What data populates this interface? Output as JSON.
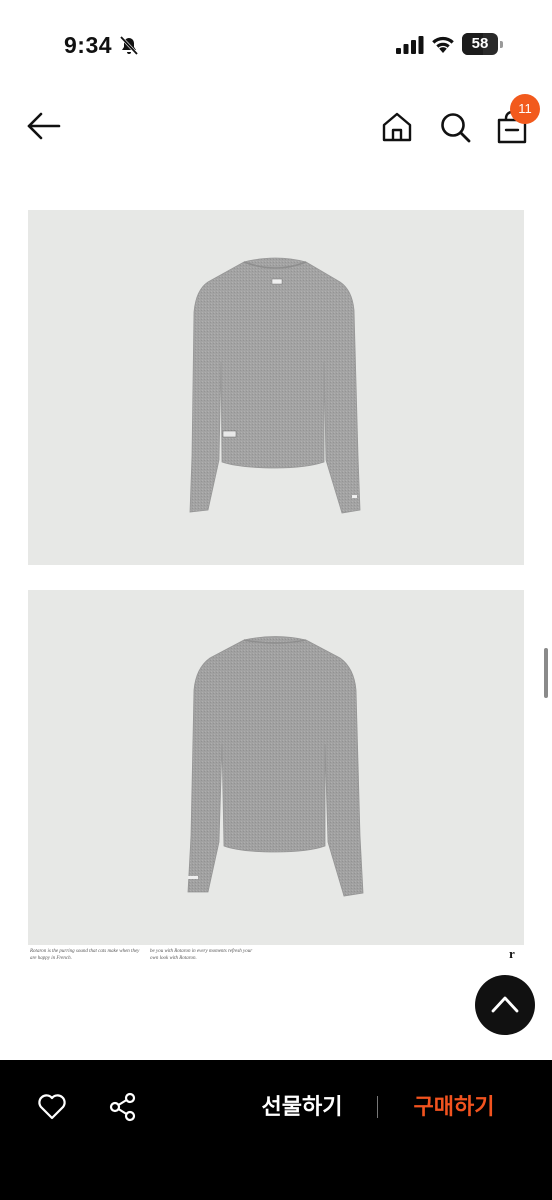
{
  "status_bar": {
    "time": "9:34",
    "battery_level": "58"
  },
  "nav": {
    "cart_count": "11"
  },
  "product_images": [
    {
      "view": "front",
      "color": "#a2a2a2"
    },
    {
      "view": "back",
      "color": "#a0a0a0"
    }
  ],
  "footer": {
    "caption_left": "Rotaron is the purring sound that cats make when they are happy in French.",
    "caption_right": "be you with Rotaron in every moments refresh your own look with Rotaron.",
    "brand_mark": "r"
  },
  "actions": {
    "gift_label": "선물하기",
    "buy_label": "구매하기"
  },
  "colors": {
    "accent": "#f25a1d",
    "bar_bg": "#000000",
    "image_bg": "#e7e8e6"
  }
}
